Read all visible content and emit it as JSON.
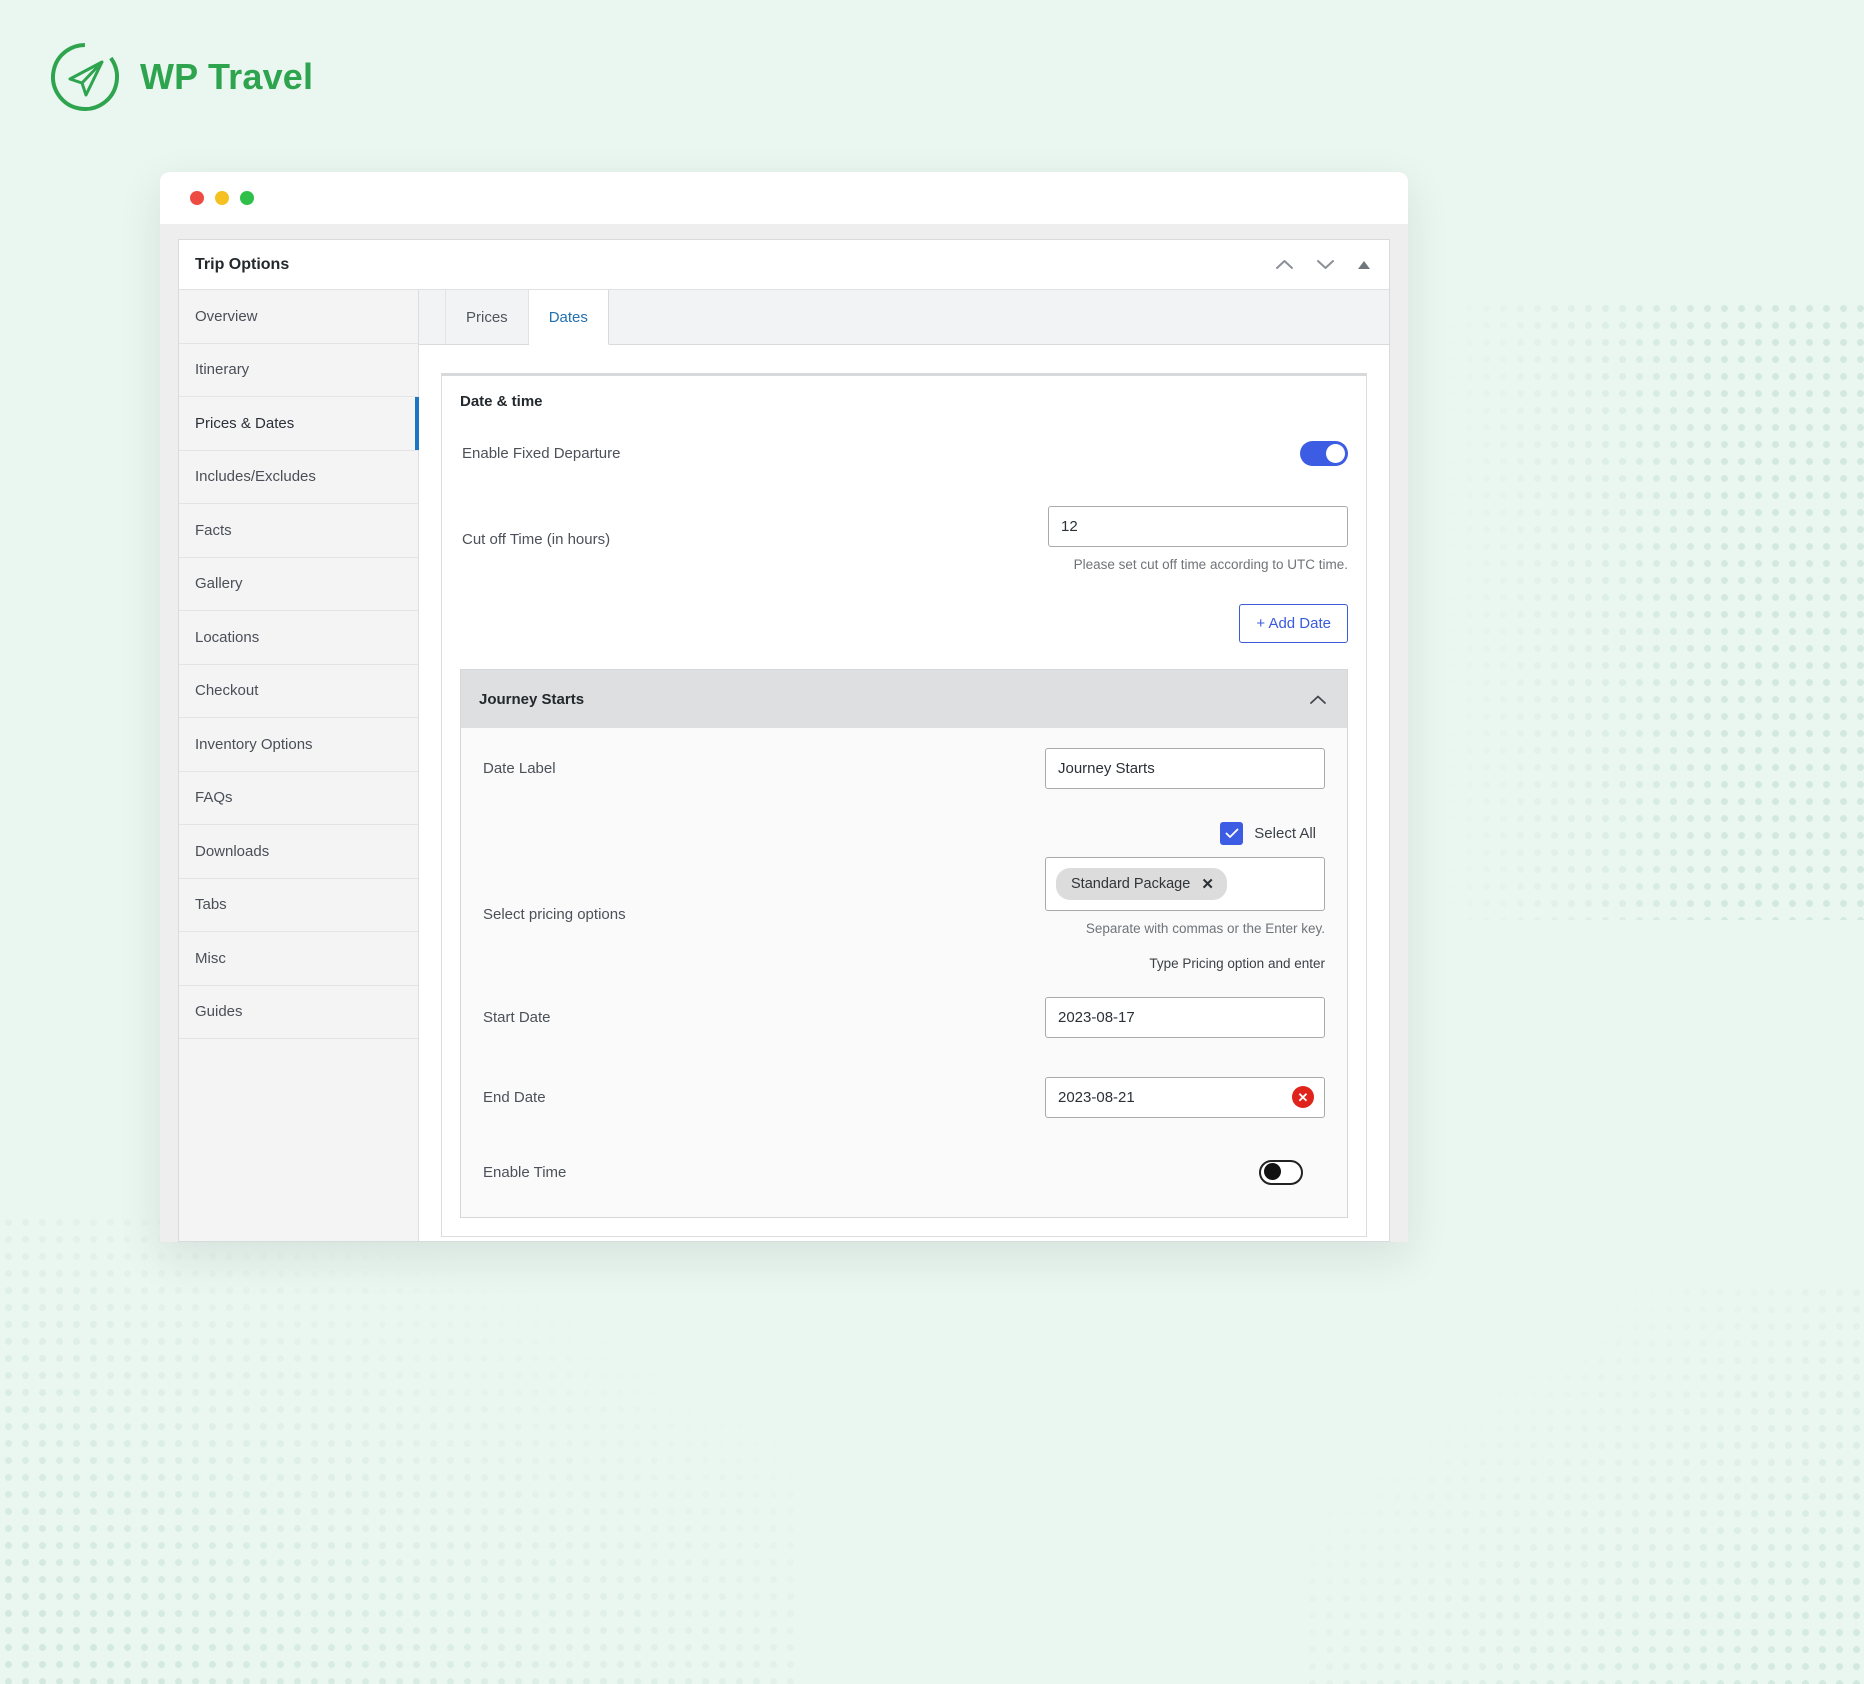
{
  "brand": {
    "name": "WP Travel",
    "logo_icon": "paper-plane-circle-icon",
    "accent": "#2ea44f"
  },
  "window": {
    "traffic_lights": [
      "close",
      "minimize",
      "maximize"
    ],
    "colors": {
      "close": "#ed4c43",
      "minimize": "#f5c021",
      "maximize": "#2fc04a"
    }
  },
  "panel": {
    "title": "Trip Options",
    "actions": [
      {
        "name": "move-up",
        "icon": "chevron-up-icon"
      },
      {
        "name": "move-down",
        "icon": "chevron-down-icon"
      },
      {
        "name": "collapse",
        "icon": "triangle-up-icon"
      }
    ]
  },
  "sidebar": {
    "items": [
      {
        "label": "Overview",
        "active": false
      },
      {
        "label": "Itinerary",
        "active": false
      },
      {
        "label": "Prices & Dates",
        "active": true
      },
      {
        "label": "Includes/Excludes",
        "active": false
      },
      {
        "label": "Facts",
        "active": false
      },
      {
        "label": "Gallery",
        "active": false
      },
      {
        "label": "Locations",
        "active": false
      },
      {
        "label": "Checkout",
        "active": false
      },
      {
        "label": "Inventory Options",
        "active": false
      },
      {
        "label": "FAQs",
        "active": false
      },
      {
        "label": "Downloads",
        "active": false
      },
      {
        "label": "Tabs",
        "active": false
      },
      {
        "label": "Misc",
        "active": false
      },
      {
        "label": "Guides",
        "active": false
      }
    ]
  },
  "tabs": [
    {
      "label": "Prices",
      "active": false
    },
    {
      "label": "Dates",
      "active": true
    }
  ],
  "date_time_card": {
    "title": "Date & time",
    "fixed_departure": {
      "label": "Enable Fixed Departure",
      "state": "on"
    },
    "cut_off_time": {
      "label": "Cut off Time (in hours)",
      "value": "12",
      "placeholder": "",
      "hint": "Please set cut off time according to UTC time."
    },
    "add_date_button": "+ Add Date"
  },
  "journey_section": {
    "title": "Journey Starts",
    "caret": "chevron-up-icon",
    "date_label": {
      "label": "Date Label",
      "value": "Journey Starts",
      "placeholder": ""
    },
    "select_all": {
      "label": "Select All",
      "checked": true
    },
    "pricing_options": {
      "label": "Select pricing options",
      "tags": [
        {
          "label": "Standard Package"
        }
      ],
      "hint": "Separate with commas or the Enter key.",
      "hint2": "Type Pricing option and enter",
      "placeholder": ""
    },
    "start_date": {
      "label": "Start Date",
      "value": "2023-08-17",
      "placeholder": ""
    },
    "end_date": {
      "label": "End Date",
      "value": "2023-08-21",
      "placeholder": "",
      "clear_badge": "✕"
    },
    "enable_time": {
      "label": "Enable Time",
      "state": "off"
    }
  },
  "colors": {
    "toggle_on": "#3c5ce3",
    "checkbox": "#3c5ce3",
    "tab_active": "#2271b1",
    "button_accent": "#3b5bdb",
    "clear_badge": "#e0231b",
    "sidebar_active_bar": "#1d76c4"
  }
}
